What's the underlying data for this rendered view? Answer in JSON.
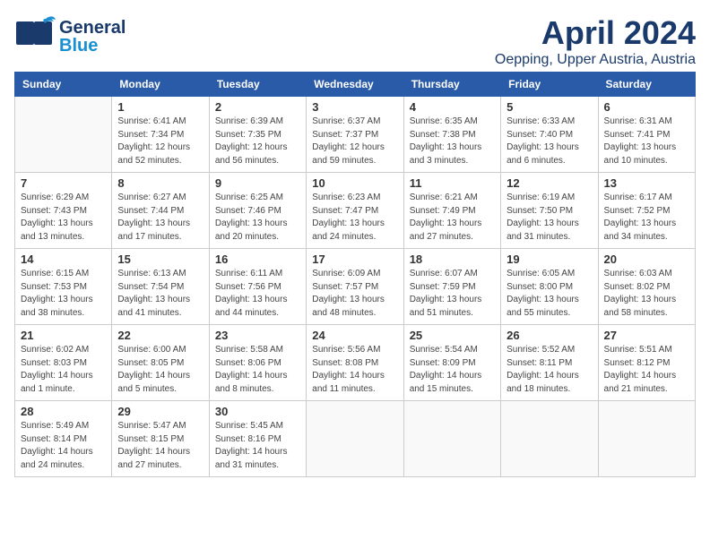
{
  "header": {
    "logo_general": "General",
    "logo_blue": "Blue",
    "month": "April 2024",
    "location": "Oepping, Upper Austria, Austria"
  },
  "weekdays": [
    "Sunday",
    "Monday",
    "Tuesday",
    "Wednesday",
    "Thursday",
    "Friday",
    "Saturday"
  ],
  "weeks": [
    [
      {
        "day": "",
        "detail": ""
      },
      {
        "day": "1",
        "detail": "Sunrise: 6:41 AM\nSunset: 7:34 PM\nDaylight: 12 hours\nand 52 minutes."
      },
      {
        "day": "2",
        "detail": "Sunrise: 6:39 AM\nSunset: 7:35 PM\nDaylight: 12 hours\nand 56 minutes."
      },
      {
        "day": "3",
        "detail": "Sunrise: 6:37 AM\nSunset: 7:37 PM\nDaylight: 12 hours\nand 59 minutes."
      },
      {
        "day": "4",
        "detail": "Sunrise: 6:35 AM\nSunset: 7:38 PM\nDaylight: 13 hours\nand 3 minutes."
      },
      {
        "day": "5",
        "detail": "Sunrise: 6:33 AM\nSunset: 7:40 PM\nDaylight: 13 hours\nand 6 minutes."
      },
      {
        "day": "6",
        "detail": "Sunrise: 6:31 AM\nSunset: 7:41 PM\nDaylight: 13 hours\nand 10 minutes."
      }
    ],
    [
      {
        "day": "7",
        "detail": "Sunrise: 6:29 AM\nSunset: 7:43 PM\nDaylight: 13 hours\nand 13 minutes."
      },
      {
        "day": "8",
        "detail": "Sunrise: 6:27 AM\nSunset: 7:44 PM\nDaylight: 13 hours\nand 17 minutes."
      },
      {
        "day": "9",
        "detail": "Sunrise: 6:25 AM\nSunset: 7:46 PM\nDaylight: 13 hours\nand 20 minutes."
      },
      {
        "day": "10",
        "detail": "Sunrise: 6:23 AM\nSunset: 7:47 PM\nDaylight: 13 hours\nand 24 minutes."
      },
      {
        "day": "11",
        "detail": "Sunrise: 6:21 AM\nSunset: 7:49 PM\nDaylight: 13 hours\nand 27 minutes."
      },
      {
        "day": "12",
        "detail": "Sunrise: 6:19 AM\nSunset: 7:50 PM\nDaylight: 13 hours\nand 31 minutes."
      },
      {
        "day": "13",
        "detail": "Sunrise: 6:17 AM\nSunset: 7:52 PM\nDaylight: 13 hours\nand 34 minutes."
      }
    ],
    [
      {
        "day": "14",
        "detail": "Sunrise: 6:15 AM\nSunset: 7:53 PM\nDaylight: 13 hours\nand 38 minutes."
      },
      {
        "day": "15",
        "detail": "Sunrise: 6:13 AM\nSunset: 7:54 PM\nDaylight: 13 hours\nand 41 minutes."
      },
      {
        "day": "16",
        "detail": "Sunrise: 6:11 AM\nSunset: 7:56 PM\nDaylight: 13 hours\nand 44 minutes."
      },
      {
        "day": "17",
        "detail": "Sunrise: 6:09 AM\nSunset: 7:57 PM\nDaylight: 13 hours\nand 48 minutes."
      },
      {
        "day": "18",
        "detail": "Sunrise: 6:07 AM\nSunset: 7:59 PM\nDaylight: 13 hours\nand 51 minutes."
      },
      {
        "day": "19",
        "detail": "Sunrise: 6:05 AM\nSunset: 8:00 PM\nDaylight: 13 hours\nand 55 minutes."
      },
      {
        "day": "20",
        "detail": "Sunrise: 6:03 AM\nSunset: 8:02 PM\nDaylight: 13 hours\nand 58 minutes."
      }
    ],
    [
      {
        "day": "21",
        "detail": "Sunrise: 6:02 AM\nSunset: 8:03 PM\nDaylight: 14 hours\nand 1 minute."
      },
      {
        "day": "22",
        "detail": "Sunrise: 6:00 AM\nSunset: 8:05 PM\nDaylight: 14 hours\nand 5 minutes."
      },
      {
        "day": "23",
        "detail": "Sunrise: 5:58 AM\nSunset: 8:06 PM\nDaylight: 14 hours\nand 8 minutes."
      },
      {
        "day": "24",
        "detail": "Sunrise: 5:56 AM\nSunset: 8:08 PM\nDaylight: 14 hours\nand 11 minutes."
      },
      {
        "day": "25",
        "detail": "Sunrise: 5:54 AM\nSunset: 8:09 PM\nDaylight: 14 hours\nand 15 minutes."
      },
      {
        "day": "26",
        "detail": "Sunrise: 5:52 AM\nSunset: 8:11 PM\nDaylight: 14 hours\nand 18 minutes."
      },
      {
        "day": "27",
        "detail": "Sunrise: 5:51 AM\nSunset: 8:12 PM\nDaylight: 14 hours\nand 21 minutes."
      }
    ],
    [
      {
        "day": "28",
        "detail": "Sunrise: 5:49 AM\nSunset: 8:14 PM\nDaylight: 14 hours\nand 24 minutes."
      },
      {
        "day": "29",
        "detail": "Sunrise: 5:47 AM\nSunset: 8:15 PM\nDaylight: 14 hours\nand 27 minutes."
      },
      {
        "day": "30",
        "detail": "Sunrise: 5:45 AM\nSunset: 8:16 PM\nDaylight: 14 hours\nand 31 minutes."
      },
      {
        "day": "",
        "detail": ""
      },
      {
        "day": "",
        "detail": ""
      },
      {
        "day": "",
        "detail": ""
      },
      {
        "day": "",
        "detail": ""
      }
    ]
  ]
}
